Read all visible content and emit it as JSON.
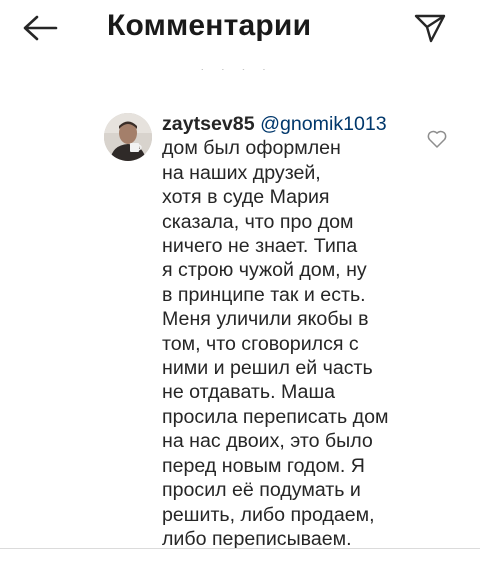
{
  "header": {
    "title": "Комментарии",
    "back_icon": "arrow-left-icon",
    "send_icon": "paper-plane-icon"
  },
  "partial_text": "· · · ·",
  "comment": {
    "avatar_icon": "user-avatar",
    "username": "zaytsev85",
    "mention": "@gnomik1013",
    "lines": [
      "дом был оформлен",
      "на наших друзей,",
      "хотя в суде Мария",
      "сказала, что про дом",
      "ничего не знает. Типа",
      "я строю чужой дом, ну",
      "в принципе так и есть.",
      "Меня уличили якобы в",
      "том, что сговорился с",
      "ними и решил ей часть",
      "не отдавать. Маша",
      "просила переписать дом",
      "на нас двоих, это было",
      "перед новым годом. Я",
      "просил её подумать и",
      "решить, либо продаем,",
      "либо переписываем."
    ],
    "like_icon": "heart-outline-icon"
  },
  "colors": {
    "text": "#262626",
    "mention": "#00376b",
    "muted": "#8e8e8e"
  }
}
